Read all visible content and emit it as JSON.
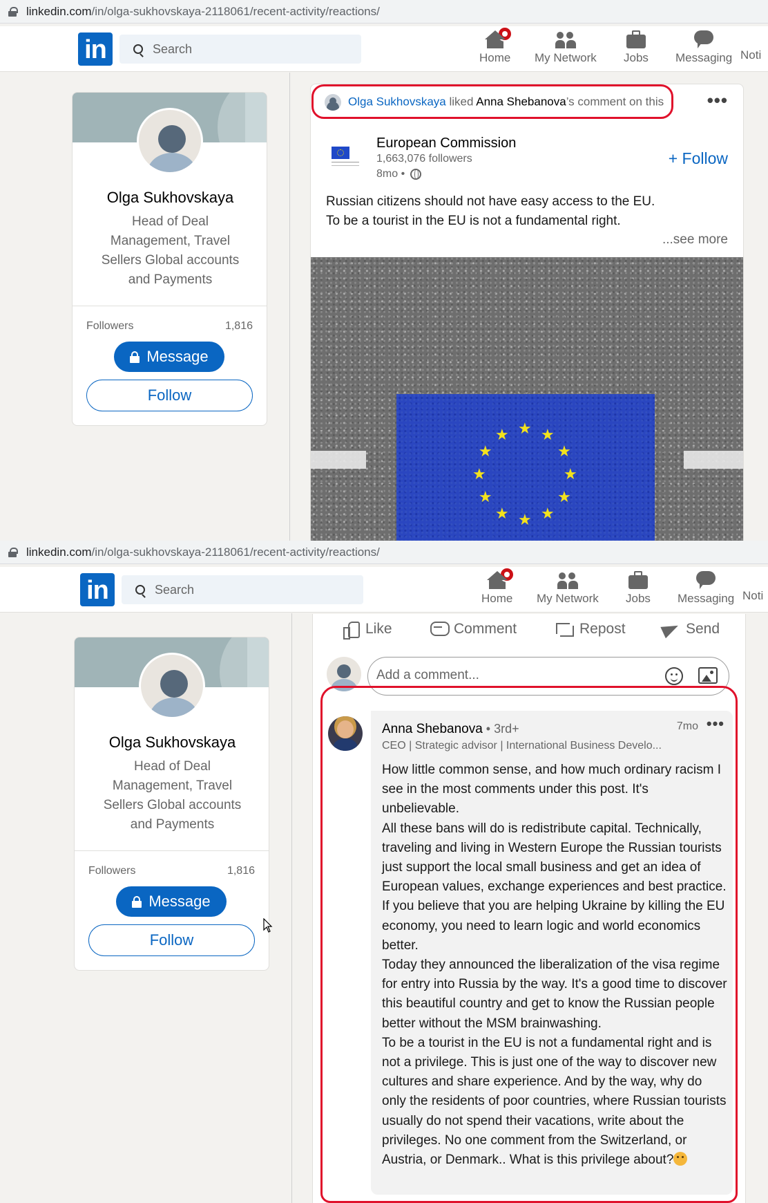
{
  "url": {
    "host": "linkedin.com",
    "path": "/in/olga-sukhovskaya-2118061/recent-activity/reactions/"
  },
  "nav": {
    "logo": "in",
    "search_placeholder": "Search",
    "items": [
      {
        "label": "Home",
        "icon": "home-icon"
      },
      {
        "label": "My Network",
        "icon": "network-icon"
      },
      {
        "label": "Jobs",
        "icon": "jobs-icon"
      },
      {
        "label": "Messaging",
        "icon": "messaging-icon"
      },
      {
        "label": "Noti",
        "icon": "notifications-icon"
      }
    ]
  },
  "profile": {
    "name": "Olga Sukhovskaya",
    "headline": "Head of Deal Management, Travel Sellers Global accounts and Payments",
    "followers_label": "Followers",
    "followers_count": "1,816",
    "message_label": "Message",
    "follow_label": "Follow"
  },
  "activity": {
    "actor": "Olga Sukhovskaya",
    "verb": " liked ",
    "target": "Anna Shebanova",
    "suffix": "’s comment on this"
  },
  "post": {
    "org_name": "European Commission",
    "followers": "1,663,076 followers",
    "time": "8mo •",
    "follow_label": "+ Follow",
    "text_line1": "Russian citizens should not have easy access to the EU.",
    "text_line2": "To be a tourist in the EU is not a fundamental right.",
    "see_more": "...see more"
  },
  "actions": {
    "like": "Like",
    "comment": "Comment",
    "repost": "Repost",
    "send": "Send"
  },
  "comment_input": {
    "placeholder": "Add a comment..."
  },
  "comment": {
    "author": "Anna Shebanova",
    "degree": " • 3rd+",
    "headline": "CEO | Strategic advisor | International Business Develo...",
    "time": "7mo",
    "paragraphs": [
      "How little common sense, and how much ordinary racism I see in the most comments under this post. It's unbelievable.",
      "All these bans will do is redistribute capital. Technically, traveling and living in Western Europe the Russian tourists just support the local small business and get an idea of European values, exchange experiences and best practice. If you believe that you are helping Ukraine by killing the EU economy, you need to learn logic and world economics better.",
      "Today they announced the liberalization of the visa regime for entry into Russia by the way. It's a good time to discover this beautiful country and get to know the Russian people better without the MSM brainwashing.",
      "To be a tourist in the EU is not a fundamental right and is not a privilege. This is just one of the way to discover new cultures and share experience. And by the way, why do only the residents of poor countries, where Russian tourists usually do not spend their vacations, write about the privileges. No one comment from the Switzerland, or Austria, or Denmark.. What is this privilege about?"
    ],
    "emoji": "thinking-face-emoji"
  },
  "colors": {
    "brand": "#0a66c2",
    "highlight": "#e0112b",
    "eu_blue": "#2a46c0",
    "eu_star": "#f3e21d"
  }
}
